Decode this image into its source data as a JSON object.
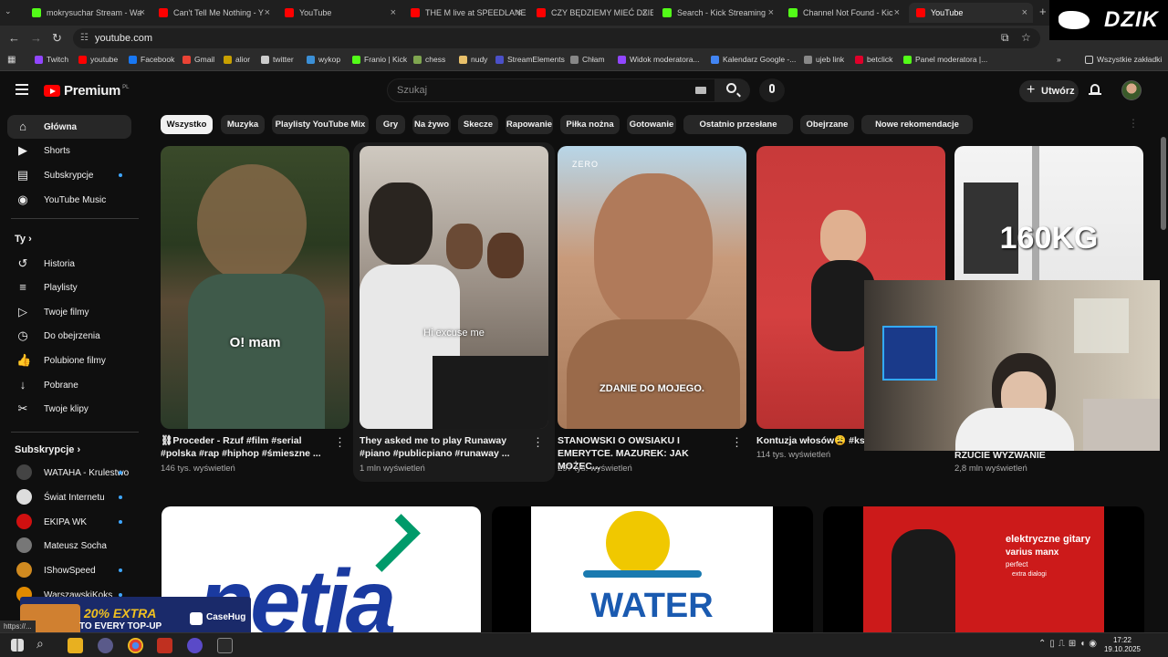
{
  "browser": {
    "tabs": [
      {
        "label": "mokrysuchar Stream - Wa",
        "color": "#53fc18"
      },
      {
        "label": "Can't Tell Me Nothing - Y",
        "color": "#ff0000"
      },
      {
        "label": "YouTube",
        "color": "#ff0000"
      },
      {
        "label": "THE M live at SPEEDLANE",
        "color": "#ff0000"
      },
      {
        "label": "CZY BĘDZIEMY MIEĆ DZIE",
        "color": "#ff0000"
      },
      {
        "label": "Search - Kick Streaming",
        "color": "#53fc18"
      },
      {
        "label": "Channel Not Found - Kic",
        "color": "#53fc18"
      },
      {
        "label": "YouTube",
        "color": "#ff0000"
      }
    ],
    "url": "youtube.com",
    "bookmarks": [
      {
        "label": "Twitch",
        "color": "#9146ff"
      },
      {
        "label": "youtube",
        "color": "#ff0000"
      },
      {
        "label": "Facebook",
        "color": "#1877f2"
      },
      {
        "label": "Gmail",
        "color": "#ea4335"
      },
      {
        "label": "alior",
        "color": "#c8a000"
      },
      {
        "label": "twitter",
        "color": "#cccccc"
      },
      {
        "label": "wykop",
        "color": "#3b8fd6"
      },
      {
        "label": "Franio | Kick",
        "color": "#53fc18"
      },
      {
        "label": "chess",
        "color": "#7fa650"
      },
      {
        "label": "nudy",
        "color": "#e8c06a"
      },
      {
        "label": "StreamElements",
        "color": "#4b50c8"
      },
      {
        "label": "Chłam",
        "color": "#888888"
      },
      {
        "label": "Widok moderatora...",
        "color": "#9146ff"
      },
      {
        "label": "Kalendarz Google -...",
        "color": "#4285f4"
      },
      {
        "label": "ujeb link",
        "color": "#888888"
      },
      {
        "label": "betclick",
        "color": "#e0002a"
      },
      {
        "label": "Panel moderatora |...",
        "color": "#53fc18"
      }
    ],
    "all_bookmarks": "Wszystkie zakładki",
    "overlay_brand": "DZIK",
    "status_url": "https://..."
  },
  "header": {
    "logo": "Premium",
    "logo_region": "PL",
    "search_placeholder": "Szukaj",
    "create_label": "Utwórz"
  },
  "sidebar": {
    "main": [
      {
        "label": "Główna",
        "icon": "home-icon"
      },
      {
        "label": "Shorts",
        "icon": "shorts-icon"
      },
      {
        "label": "Subskrypcje",
        "icon": "subscriptions-icon",
        "dot": true
      },
      {
        "label": "YouTube Music",
        "icon": "music-icon"
      }
    ],
    "you_heading": "Ty",
    "you": [
      {
        "label": "Historia",
        "icon": "history-icon"
      },
      {
        "label": "Playlisty",
        "icon": "playlist-icon"
      },
      {
        "label": "Twoje filmy",
        "icon": "your-videos-icon"
      },
      {
        "label": "Do obejrzenia",
        "icon": "watch-later-icon"
      },
      {
        "label": "Polubione filmy",
        "icon": "like-icon"
      },
      {
        "label": "Pobrane",
        "icon": "download-icon"
      },
      {
        "label": "Twoje klipy",
        "icon": "clips-icon"
      }
    ],
    "subs_heading": "Subskrypcje",
    "subs": [
      {
        "label": "WATAHA - Krulestwo",
        "color": "#444444",
        "dot": true
      },
      {
        "label": "Świat Internetu",
        "color": "#dddddd",
        "dot": true
      },
      {
        "label": "EKIPA WK",
        "color": "#d01010",
        "dot": true
      },
      {
        "label": "Mateusz Socha",
        "color": "#777777",
        "dot": false
      },
      {
        "label": "IShowSpeed",
        "color": "#d08a20",
        "dot": true
      },
      {
        "label": "WarszawskiKoks",
        "color": "#e08a00",
        "dot": true
      }
    ]
  },
  "chips": [
    "Wszystko",
    "Muzyka",
    "Playlisty YouTube Mix",
    "Gry",
    "Na żywo",
    "Skecze",
    "Rapowanie",
    "Piłka nożna",
    "Gotowanie",
    "Ostatnio przesłane",
    "Obejrzane",
    "Nowe rekomendacje"
  ],
  "shorts": [
    {
      "title": "⛓Proceder - Rzuf #film #serial #polska #rap #hiphop #śmieszne ...",
      "views": "146 tys. wyświetleń",
      "caption": "O! mam"
    },
    {
      "title": "They asked me to play Runaway #piano #publicpiano #runaway ...",
      "views": "1 mln wyświetleń",
      "caption": "Hi excuse me"
    },
    {
      "title": "STANOWSKI O OWSIAKU I EMERYTCE. MAZUREK: JAK MOŻEC...",
      "views": "297 tys. wyświetleń",
      "caption": "ZDANIE DO MOJEGO.",
      "watermark": "ZERO"
    },
    {
      "title": "Kontuzja włosów😩 #ksw",
      "views": "114 tys. wyświetleń",
      "caption": ""
    },
    {
      "title": "RZUCIE WYZWANIE",
      "views": "2,8 mln wyświetleń",
      "caption": "160KG"
    }
  ],
  "videos": [
    {
      "thumb_text": "netia"
    },
    {
      "thumb_text": "WATER"
    },
    {
      "thumb_text": "elektryczne gitary",
      "thumb_sub1": "varius manx",
      "thumb_sub2": "perfect",
      "thumb_sub3": "extra dialogi"
    }
  ],
  "ad": {
    "line1": "20% EXTRA",
    "line2": "TO EVERY TOP-UP",
    "brand": "CaseHug"
  },
  "clock": {
    "time": "17:22",
    "date": "19.10.2025"
  }
}
